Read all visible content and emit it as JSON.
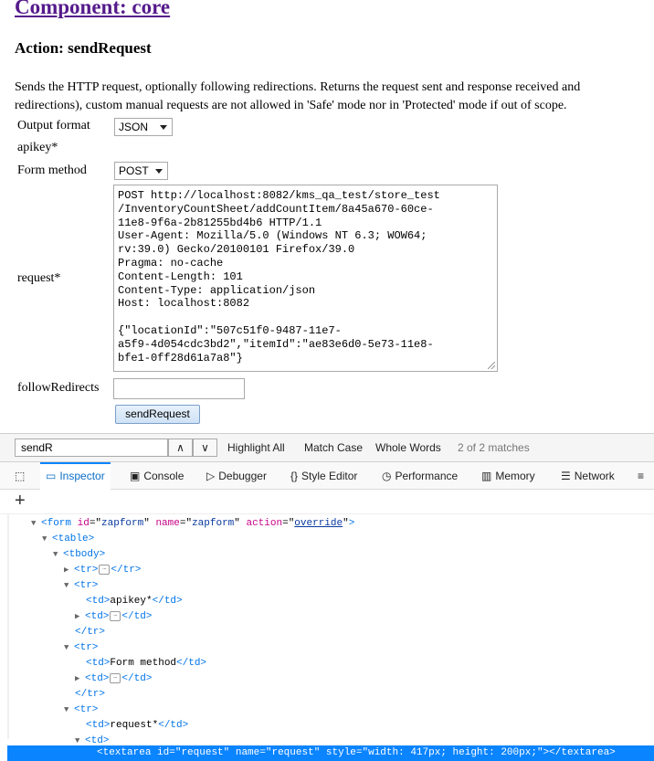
{
  "page": {
    "component_title": "Component: core",
    "action_title": "Action: sendRequest",
    "description_line1": "Sends the HTTP request, optionally following redirections. Returns the request sent and response received and",
    "description_line2": "redirections), custom manual requests are not allowed in 'Safe' mode nor in 'Protected' mode if out of scope."
  },
  "form": {
    "output_format_label": "Output format",
    "output_format_value": "JSON",
    "apikey_label": "apikey*",
    "form_method_label": "Form method",
    "form_method_value": "POST",
    "request_label": "request*",
    "request_lines": [
      "POST http://localhost:8082/kms_qa_test/store_test",
      "/InventoryCountSheet/addCountItem/8a45a670-60ce-",
      "11e8-9f6a-2b81255bd4b6 HTTP/1.1",
      "User-Agent: Mozilla/5.0 (Windows NT 6.3; WOW64;",
      "rv:39.0) Gecko/20100101 Firefox/39.0",
      "Pragma: no-cache",
      "Content-Length: 101",
      "Content-Type: application/json",
      "Host: localhost:8082",
      "",
      "{\"locationId\":\"507c51f0-9487-11e7-",
      "a5f9-4d054cdc3bd2\",\"itemId\":\"ae83e6d0-5e73-11e8-",
      "bfe1-0ff28d61a7a8\"}"
    ],
    "follow_redirects_label": "followRedirects",
    "follow_redirects_value": "",
    "submit_label": "sendRequest"
  },
  "findbar": {
    "query": "sendR",
    "up_arrow": "∧",
    "down_arrow": "∨",
    "highlight_all": "Highlight All",
    "match_case": "Match Case",
    "whole_words": "Whole Words",
    "match_count": "2 of 2 matches"
  },
  "devtools": {
    "tabs": [
      {
        "label": "Inspector",
        "icon": "inspector-icon",
        "active": true
      },
      {
        "label": "Console",
        "icon": "console-icon"
      },
      {
        "label": "Debugger",
        "icon": "debugger-icon"
      },
      {
        "label": "Style Editor",
        "icon": "style-editor-icon"
      },
      {
        "label": "Performance",
        "icon": "performance-icon"
      },
      {
        "label": "Memory",
        "icon": "memory-icon"
      },
      {
        "label": "Network",
        "icon": "network-icon"
      }
    ],
    "accent_color": "#0a84ff"
  },
  "tree": {
    "form_open": {
      "tag": "form",
      "id": "zapform",
      "name": "zapform",
      "action": "override"
    },
    "table": "<table>",
    "tbody": "<tbody>",
    "tr_open": "<tr>",
    "tr_close": "</tr>",
    "td_open": "<td>",
    "td_close": "</td>",
    "apikey_text": "apikey*",
    "form_method_text": "Form method",
    "request_text": "request*",
    "selected": {
      "tag": "textarea",
      "id": "request",
      "name": "request",
      "style": "width: 417px; height: 200px;"
    }
  }
}
